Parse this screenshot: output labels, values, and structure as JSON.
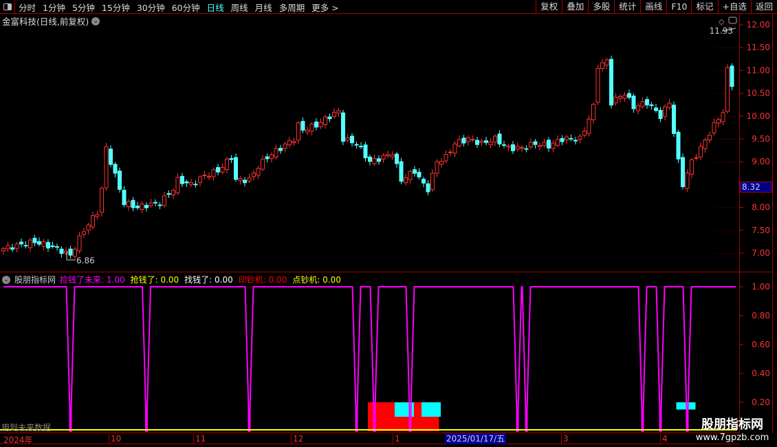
{
  "toolbar": {
    "periods": [
      "分时",
      "1分钟",
      "5分钟",
      "15分钟",
      "30分钟",
      "60分钟",
      "日线",
      "周线",
      "月线",
      "多周期",
      "更多 >"
    ],
    "active_period": "日线",
    "buttons": [
      "复权",
      "叠加",
      "多股",
      "统计",
      "画线",
      "F10",
      "标记",
      "+自选",
      "返回"
    ]
  },
  "stock": {
    "title": "金富科技(日线,前复权)",
    "high_label": "11.93",
    "low_label": "6.86",
    "current_price": "8.32"
  },
  "colors": {
    "up": "#ff3232",
    "down": "#54ffff",
    "magenta": "#ff00ff",
    "yellow": "#ffff00",
    "red": "#ff0000",
    "cyan": "#00ffff"
  },
  "chart_data": [
    {
      "type": "candlestick",
      "ylim": [
        6.6,
        12.1
      ],
      "y_ticks": [
        "12.00",
        "11.50",
        "11.00",
        "10.50",
        "10.00",
        "9.50",
        "9.00",
        "8.00",
        "7.50",
        "7.00"
      ],
      "bars": 164,
      "closes_keypoints": [
        [
          0,
          7.1
        ],
        [
          7,
          7.25
        ],
        [
          12,
          7.1
        ],
        [
          15,
          6.95
        ],
        [
          18,
          7.5
        ],
        [
          21,
          7.9
        ],
        [
          22,
          8.4
        ],
        [
          23,
          9.3
        ],
        [
          25,
          8.7
        ],
        [
          27,
          8.1
        ],
        [
          30,
          8.0
        ],
        [
          32,
          8.05
        ],
        [
          35,
          8.1
        ],
        [
          38,
          8.4
        ],
        [
          39,
          8.6
        ],
        [
          42,
          8.5
        ],
        [
          45,
          8.7
        ],
        [
          48,
          8.8
        ],
        [
          51,
          9.1
        ],
        [
          52,
          8.6
        ],
        [
          55,
          8.6
        ],
        [
          57,
          8.9
        ],
        [
          59,
          9.1
        ],
        [
          62,
          9.3
        ],
        [
          65,
          9.5
        ],
        [
          66,
          9.8
        ],
        [
          67,
          9.7
        ],
        [
          70,
          9.8
        ],
        [
          73,
          10.0
        ],
        [
          75,
          10.1
        ],
        [
          76,
          9.5
        ],
        [
          79,
          9.4
        ],
        [
          82,
          9.0
        ],
        [
          85,
          9.1
        ],
        [
          87,
          9.2
        ],
        [
          89,
          8.6
        ],
        [
          92,
          8.8
        ],
        [
          94,
          8.5
        ],
        [
          95,
          8.4
        ],
        [
          97,
          9.0
        ],
        [
          99,
          9.1
        ],
        [
          101,
          9.4
        ],
        [
          104,
          9.5
        ],
        [
          107,
          9.4
        ],
        [
          110,
          9.5
        ],
        [
          113,
          9.3
        ],
        [
          116,
          9.3
        ],
        [
          119,
          9.4
        ],
        [
          122,
          9.35
        ],
        [
          125,
          9.5
        ],
        [
          129,
          9.5
        ],
        [
          130,
          9.7
        ],
        [
          132,
          10.2
        ],
        [
          133,
          11.1
        ],
        [
          135,
          11.2
        ],
        [
          136,
          10.3
        ],
        [
          139,
          10.5
        ],
        [
          141,
          10.2
        ],
        [
          144,
          10.3
        ],
        [
          147,
          10.0
        ],
        [
          149,
          10.3
        ],
        [
          151,
          9.0
        ],
        [
          152,
          8.5
        ],
        [
          154,
          9.0
        ],
        [
          156,
          9.3
        ],
        [
          159,
          9.8
        ],
        [
          161,
          10.1
        ],
        [
          162,
          11.0
        ],
        [
          163,
          10.7
        ]
      ]
    },
    {
      "type": "line",
      "title": "股朋指标网",
      "ylim": [
        0,
        1.05
      ],
      "y_ticks": [
        "1.00",
        "0.80",
        "0.60",
        "0.40",
        "0.20"
      ],
      "legend": [
        {
          "name": "捡钱了未来",
          "value": "1.00",
          "color": "#ff00ff"
        },
        {
          "name": "抢钱了",
          "value": "0.00",
          "color": "#ffff00"
        },
        {
          "name": "找钱了",
          "value": "0.00",
          "color": "#ffffff"
        },
        {
          "name": "印钞机",
          "value": "0.00",
          "color": "#ff0000"
        },
        {
          "name": "点钞机",
          "value": "0.00",
          "color": "#ffff00"
        }
      ],
      "line_dips_at_bar": [
        15,
        32,
        55,
        79,
        83,
        91,
        115,
        117,
        143,
        147,
        153
      ],
      "red_block": {
        "bars": [
          82,
          97
        ],
        "value": 0.2
      },
      "cyan_blocks": [
        {
          "bars": [
            88,
            92
          ],
          "range": [
            0.1,
            0.2
          ]
        },
        {
          "bars": [
            94,
            98
          ],
          "range": [
            0.1,
            0.2
          ]
        },
        {
          "bars": [
            151,
            155
          ],
          "range": [
            0.15,
            0.2
          ]
        }
      ],
      "note_text": "用到未来数据"
    }
  ],
  "dates": {
    "labels": [
      "2024年",
      "10",
      "11",
      "12",
      "1",
      "3",
      "4"
    ],
    "selected": "2025/01/17/五"
  },
  "watermark": {
    "line1": "股朋指标网",
    "line2": "www.7gpzb.com"
  }
}
